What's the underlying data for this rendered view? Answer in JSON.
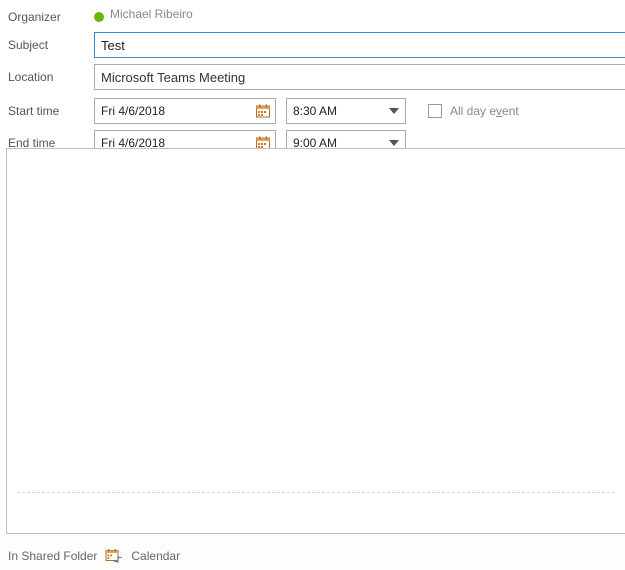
{
  "organizer": {
    "label": "Organizer",
    "name": "Michael Ribeiro"
  },
  "subject": {
    "label": "Subject",
    "value": "Test"
  },
  "location": {
    "label": "Location",
    "value": "Microsoft Teams Meeting"
  },
  "start": {
    "label": "Start time",
    "date": "Fri 4/6/2018",
    "time": "8:30 AM"
  },
  "end": {
    "label": "End time",
    "date": "Fri 4/6/2018",
    "time": "9:00 AM"
  },
  "allday": {
    "label_pre": "All day e",
    "label_u": "v",
    "label_post": "ent",
    "checked": false
  },
  "status": {
    "folder_label": "In Shared Folder",
    "calendar_label": "Calendar"
  }
}
